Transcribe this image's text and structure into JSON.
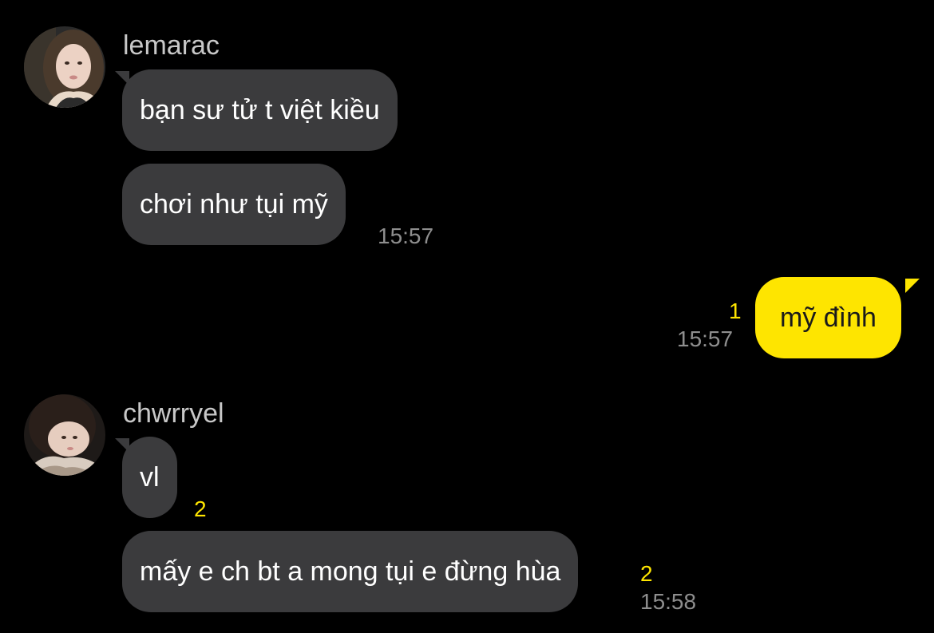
{
  "chat": {
    "groups": [
      {
        "sender": "lemarac",
        "avatar_icon": "profile-photo-woman-icon",
        "messages": [
          {
            "text": "bạn sư tử t việt kiều"
          },
          {
            "text": "chơi như tụi mỹ",
            "time": "15:57"
          }
        ]
      },
      {
        "sender": "me",
        "messages": [
          {
            "text": "mỹ đình",
            "time": "15:57",
            "unread": "1"
          }
        ]
      },
      {
        "sender": "chwrryel",
        "avatar_icon": "profile-photo-woman-icon",
        "messages": [
          {
            "text": "vl",
            "unread": "2"
          },
          {
            "text": "mấy e ch bt a mong tụi e đừng hùa",
            "time": "15:58",
            "unread": "2"
          }
        ]
      }
    ]
  },
  "colors": {
    "background": "#000000",
    "incoming_bubble": "#3b3b3d",
    "outgoing_bubble": "#fee500",
    "unread_count": "#fee500",
    "timestamp": "#8e8e8e"
  }
}
